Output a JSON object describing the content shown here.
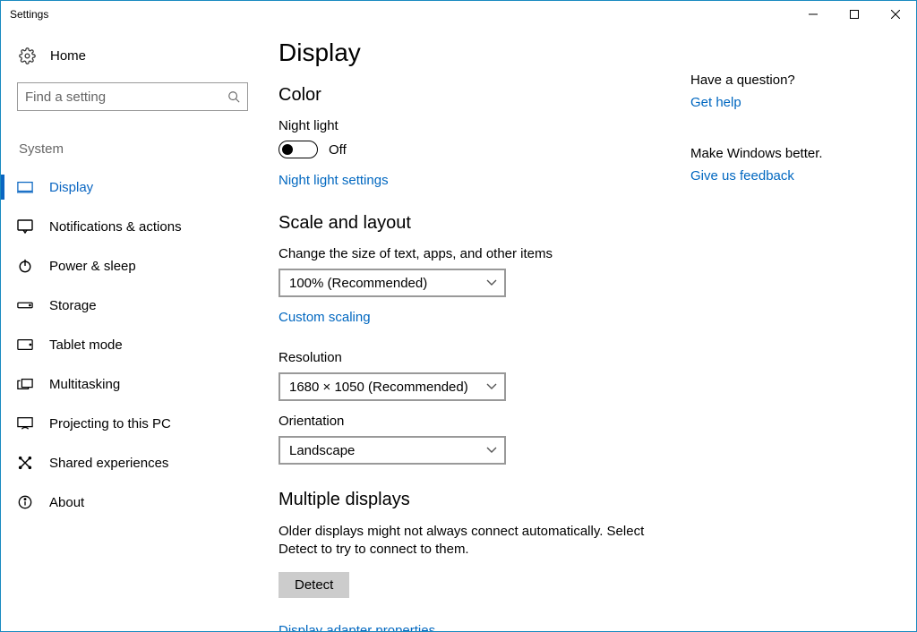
{
  "window": {
    "title": "Settings"
  },
  "nav": {
    "home_label": "Home",
    "search_placeholder": "Find a setting",
    "category": "System",
    "items": [
      {
        "label": "Display",
        "active": true
      },
      {
        "label": "Notifications & actions"
      },
      {
        "label": "Power & sleep"
      },
      {
        "label": "Storage"
      },
      {
        "label": "Tablet mode"
      },
      {
        "label": "Multitasking"
      },
      {
        "label": "Projecting to this PC"
      },
      {
        "label": "Shared experiences"
      },
      {
        "label": "About"
      }
    ]
  },
  "page": {
    "title": "Display",
    "color": {
      "heading": "Color",
      "night_light_label": "Night light",
      "night_light_state": "Off",
      "night_light_settings_link": "Night light settings"
    },
    "scale": {
      "heading": "Scale and layout",
      "size_label": "Change the size of text, apps, and other items",
      "size_value": "100% (Recommended)",
      "custom_scaling_link": "Custom scaling",
      "resolution_label": "Resolution",
      "resolution_value": "1680 × 1050 (Recommended)",
      "orientation_label": "Orientation",
      "orientation_value": "Landscape"
    },
    "multi": {
      "heading": "Multiple displays",
      "desc": "Older displays might not always connect automatically. Select Detect to try to connect to them.",
      "detect_label": "Detect",
      "adapter_link": "Display adapter properties"
    }
  },
  "aside": {
    "question_heading": "Have a question?",
    "get_help_link": "Get help",
    "improve_heading": "Make Windows better.",
    "feedback_link": "Give us feedback"
  }
}
